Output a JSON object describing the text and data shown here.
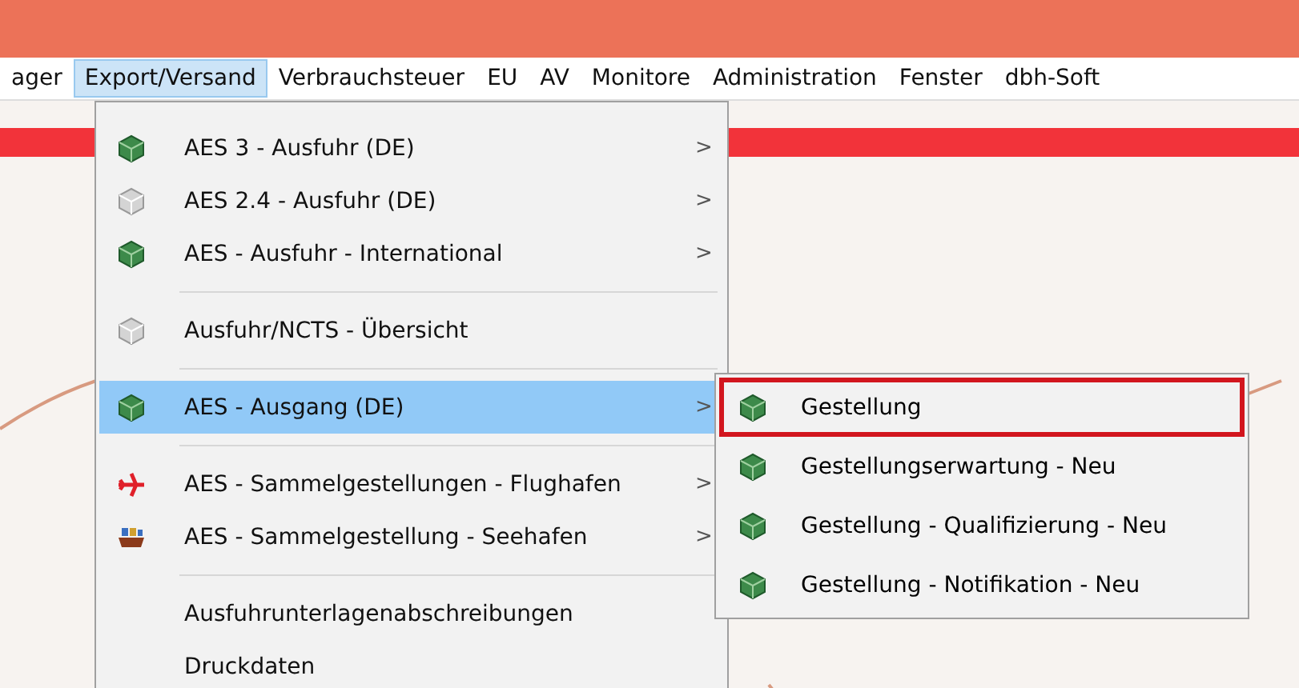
{
  "menu_bar": [
    {
      "label": "ager",
      "selected": false
    },
    {
      "label": "Export/Versand",
      "selected": true
    },
    {
      "label": "Verbrauchsteuer",
      "selected": false
    },
    {
      "label": "EU",
      "selected": false
    },
    {
      "label": "AV",
      "selected": false
    },
    {
      "label": "Monitore",
      "selected": false
    },
    {
      "label": "Administration",
      "selected": false
    },
    {
      "label": "Fenster",
      "selected": false
    },
    {
      "label": "dbh-Soft",
      "selected": false
    }
  ],
  "dropdown": [
    {
      "kind": "green-cube",
      "label": "AES 3 - Ausfuhr (DE)",
      "arrow": ">",
      "selected": false
    },
    {
      "kind": "grey-cube",
      "label": "AES 2.4 - Ausfuhr (DE)",
      "arrow": ">",
      "selected": false
    },
    {
      "kind": "green-cube",
      "label": "AES - Ausfuhr - International",
      "arrow": ">",
      "selected": false
    },
    {
      "kind": "separator"
    },
    {
      "kind": "grey-cube",
      "label": "Ausfuhr/NCTS - Übersicht",
      "selected": false
    },
    {
      "kind": "separator"
    },
    {
      "kind": "green-cube",
      "label": "AES - Ausgang (DE)",
      "arrow": ">",
      "selected": true
    },
    {
      "kind": "separator"
    },
    {
      "kind": "plane",
      "label": "AES - Sammelgestellungen - Flughafen",
      "arrow": ">",
      "selected": false
    },
    {
      "kind": "ship",
      "label": "AES - Sammelgestellung - Seehafen",
      "arrow": ">",
      "selected": false
    },
    {
      "kind": "separator"
    },
    {
      "kind": "plain",
      "label": "Ausfuhrunterlagenabschreibungen",
      "selected": false
    },
    {
      "kind": "plain",
      "label": "Druckdaten",
      "selected": false
    }
  ],
  "submenu": [
    {
      "label": "Gestellung",
      "highlighted": true
    },
    {
      "label": "Gestellungserwartung - Neu",
      "highlighted": false
    },
    {
      "label": "Gestellung - Qualifizierung - Neu",
      "highlighted": false
    },
    {
      "label": "Gestellung - Notifikation - Neu",
      "highlighted": false
    }
  ]
}
